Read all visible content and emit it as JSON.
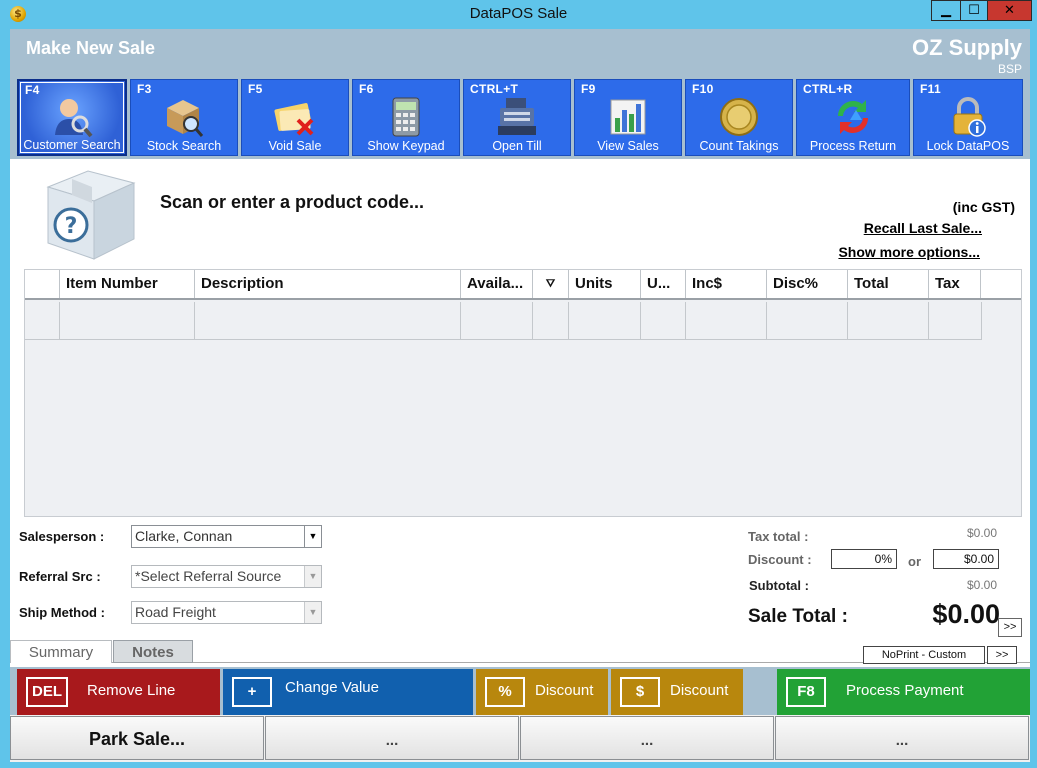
{
  "window": {
    "title": "DataPOS Sale",
    "controls": {
      "minimize": "▁",
      "maximize": "☐",
      "close": "✕"
    }
  },
  "header": {
    "heading": "Make New Sale",
    "company": "OZ Supply",
    "company_sub": "BSP"
  },
  "toolbar": [
    {
      "key": "F4",
      "label": "Customer Search",
      "icon": "customer-search-icon",
      "active": true
    },
    {
      "key": "F3",
      "label": "Stock Search",
      "icon": "stock-search-icon"
    },
    {
      "key": "F5",
      "label": "Void Sale",
      "icon": "void-sale-icon"
    },
    {
      "key": "F6",
      "label": "Show Keypad",
      "icon": "keypad-icon"
    },
    {
      "key": "CTRL+T",
      "label": "Open Till",
      "icon": "cash-register-icon"
    },
    {
      "key": "F9",
      "label": "View Sales",
      "icon": "bar-chart-icon"
    },
    {
      "key": "F10",
      "label": "Count Takings",
      "icon": "coin-icon"
    },
    {
      "key": "CTRL+R",
      "label": "Process Return",
      "icon": "return-arrows-icon"
    },
    {
      "key": "F11",
      "label": "Lock DataPOS",
      "icon": "padlock-icon"
    }
  ],
  "scan": {
    "prompt": "Scan or enter a product code...",
    "inc_gst": "(inc GST)",
    "recall_link": "Recall Last Sale...",
    "more_options_link": "Show more options..."
  },
  "grid": {
    "columns": [
      "",
      "Item Number",
      "Description",
      "Availa...",
      "",
      "Units",
      "U...",
      "Inc$",
      "Disc%",
      "Total",
      "Tax"
    ],
    "filter_glyph": "⛛",
    "rows": [
      [
        "",
        "",
        "",
        "",
        "",
        "",
        "",
        "",
        "",
        "",
        ""
      ]
    ]
  },
  "fields": {
    "salesperson": {
      "label": "Salesperson :",
      "value": "Clarke, Connan"
    },
    "referral": {
      "label": "Referral Src :",
      "value": "*Select Referral Source"
    },
    "ship": {
      "label": "Ship Method :",
      "value": "Road Freight"
    }
  },
  "totals": {
    "tax_label": "Tax total :",
    "tax_value": "$0.00",
    "discount_label": "Discount :",
    "discount_percent": "0%",
    "or_label": "or",
    "discount_amount": "$0.00",
    "subtotal_label": "Subtotal :",
    "subtotal_value": "$0.00",
    "sale_total_label": "Sale Total :",
    "sale_total_value": "$0.00",
    "expand": ">>"
  },
  "tabs": {
    "summary": "Summary",
    "notes": "Notes"
  },
  "print": {
    "mode": "NoPrint - Custom",
    "more": ">>"
  },
  "actions": [
    {
      "badge": "DEL",
      "label": "Remove Line",
      "color": "#a8191c"
    },
    {
      "badge": "+",
      "label": "Change Value",
      "color": "#1160ae"
    },
    {
      "badge": "%",
      "label": "Discount",
      "color": "#b8870d"
    },
    {
      "badge": "$",
      "label": "Discount",
      "color": "#b8870d"
    },
    {
      "badge": "F8",
      "label": "Process Payment",
      "color": "#22a236"
    }
  ],
  "park": {
    "park_label": "Park Sale...",
    "slot2": "...",
    "slot3": "...",
    "slot4": "..."
  }
}
